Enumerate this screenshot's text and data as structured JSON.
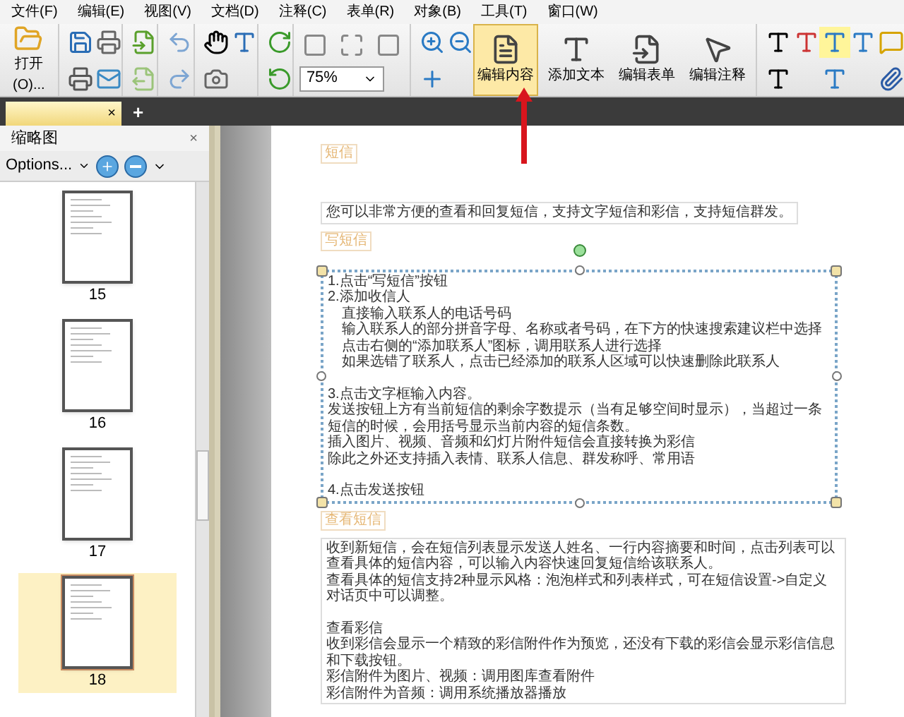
{
  "menu": [
    "文件(F)",
    "编辑(E)",
    "视图(V)",
    "文档(D)",
    "注释(C)",
    "表单(R)",
    "对象(B)",
    "工具(T)",
    "窗口(W)"
  ],
  "toolbar": {
    "open_label": "打开(O)...",
    "zoom_value": "75%",
    "tools": [
      {
        "label": "编辑内容",
        "selected": true
      },
      {
        "label": "添加文本",
        "selected": false
      },
      {
        "label": "编辑表单",
        "selected": false
      },
      {
        "label": "编辑注释",
        "selected": false
      }
    ]
  },
  "tab_close": "×",
  "tab_add": "+",
  "sidebar": {
    "title": "缩略图",
    "close": "×",
    "options": "Options...",
    "pages": [
      {
        "number": "15",
        "selected": false
      },
      {
        "number": "16",
        "selected": false
      },
      {
        "number": "17",
        "selected": false
      },
      {
        "number": "18",
        "selected": true
      }
    ]
  },
  "document": {
    "blocks": [
      {
        "kind": "heading",
        "text": "短信"
      },
      {
        "kind": "box",
        "lines": [
          {
            "text": "您可以非常方便的查看和回复短信，支持文字短信和彩信，支持短信群发。",
            "space_before": false
          }
        ]
      },
      {
        "kind": "heading",
        "text": "写短信"
      },
      {
        "kind": "selected",
        "lines": [
          {
            "text": "1.点击“写短信”按钮",
            "space_before": false
          },
          {
            "text": "2.添加收信人",
            "space_before": false
          },
          {
            "text": "　直接输入联系人的电话号码",
            "space_before": false
          },
          {
            "text": "　输入联系人的部分拼音字母、名称或者号码，在下方的快速搜索建议栏中选择",
            "space_before": false
          },
          {
            "text": "　点击右侧的“添加联系人”图标，调用联系人进行选择",
            "space_before": false
          },
          {
            "text": "　如果选错了联系人，点击已经添加的联系人区域可以快速删除此联系人",
            "space_before": false
          },
          {
            "text": "3.点击文字框输入内容。",
            "space_before": true
          },
          {
            "text": "发送按钮上方有当前短信的剩余字数提示（当有足够空间时显示），当超过一条短信的时候，会用括号显示当前内容的短信条数。",
            "space_before": false
          },
          {
            "text": "插入图片、视频、音频和幻灯片附件短信会直接转换为彩信",
            "space_before": false
          },
          {
            "text": "除此之外还支持插入表情、联系人信息、群发称呼、常用语",
            "space_before": false
          },
          {
            "text": "4.点击发送按钮",
            "space_before": true
          }
        ]
      },
      {
        "kind": "heading",
        "text": "查看短信"
      },
      {
        "kind": "box",
        "lines": [
          {
            "text": "收到新短信，会在短信列表显示发送人姓名、一行内容摘要和时间，点击列表可以查看具体的短信内容，可以输入内容快速回复短信给该联系人。",
            "space_before": false
          },
          {
            "text": "查看具体的短信支持2种显示风格：泡泡样式和列表样式，可在短信设置->自定义对话页中可以调整。",
            "space_before": false
          },
          {
            "text": "查看彩信",
            "space_before": true
          },
          {
            "text": "收到彩信会显示一个精致的彩信附件作为预览，还没有下载的彩信会显示彩信信息和下载按钮。",
            "space_before": false
          },
          {
            "text": "彩信附件为图片、视频：调用图库查看附件",
            "space_before": false
          },
          {
            "text": "彩信附件为音频：调用系统播放器播放",
            "space_before": false
          }
        ]
      }
    ]
  }
}
